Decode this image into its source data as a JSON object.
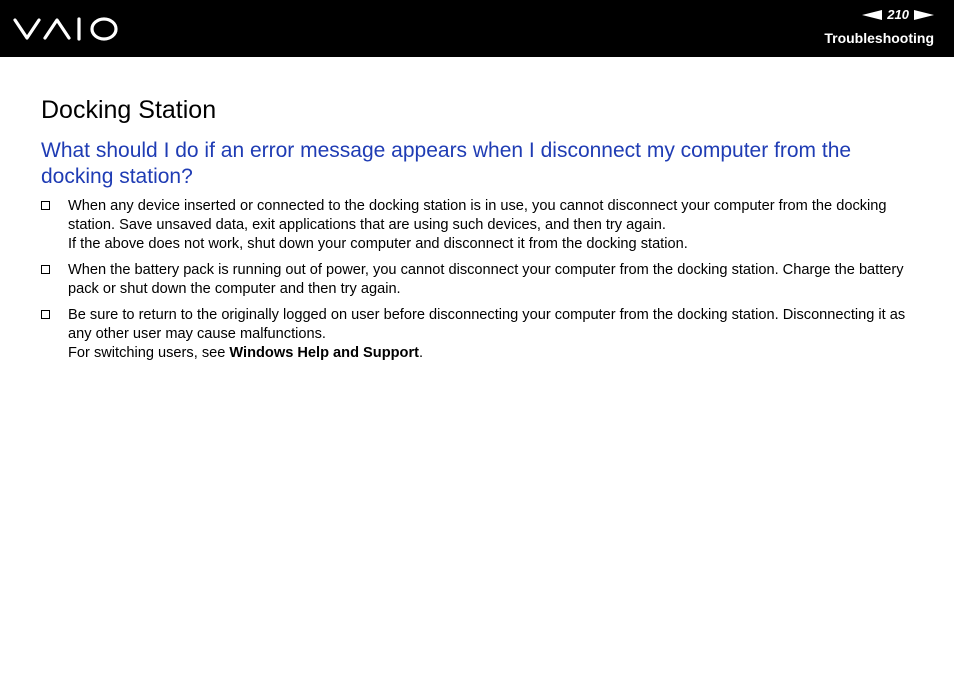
{
  "header": {
    "logo": "VAIO",
    "page_number": "210",
    "section": "Troubleshooting",
    "prev_icon": "arrow-left-icon",
    "next_icon": "arrow-right-icon"
  },
  "content": {
    "title": "Docking Station",
    "question": "What should I do if an error message appears when I disconnect my computer from the docking station?",
    "items": [
      {
        "para1": "When any device inserted or connected to the docking station is in use, you cannot disconnect your computer from the docking station. Save unsaved data, exit applications that are using such devices, and then try again.",
        "para2": "If the above does not work, shut down your computer and disconnect it from the docking station."
      },
      {
        "para1": "When the battery pack is running out of power, you cannot disconnect your computer from the docking station. Charge the battery pack or shut down the computer and then try again."
      },
      {
        "para1": "Be sure to return to the originally logged on user before disconnecting your computer from the docking station. Disconnecting it as any other user may cause malfunctions.",
        "para2_prefix": "For switching users, see ",
        "para2_link": "Windows Help and Support",
        "para2_suffix": "."
      }
    ]
  },
  "colors": {
    "header_bg": "#000000",
    "heading_blue": "#1f3cb4"
  }
}
